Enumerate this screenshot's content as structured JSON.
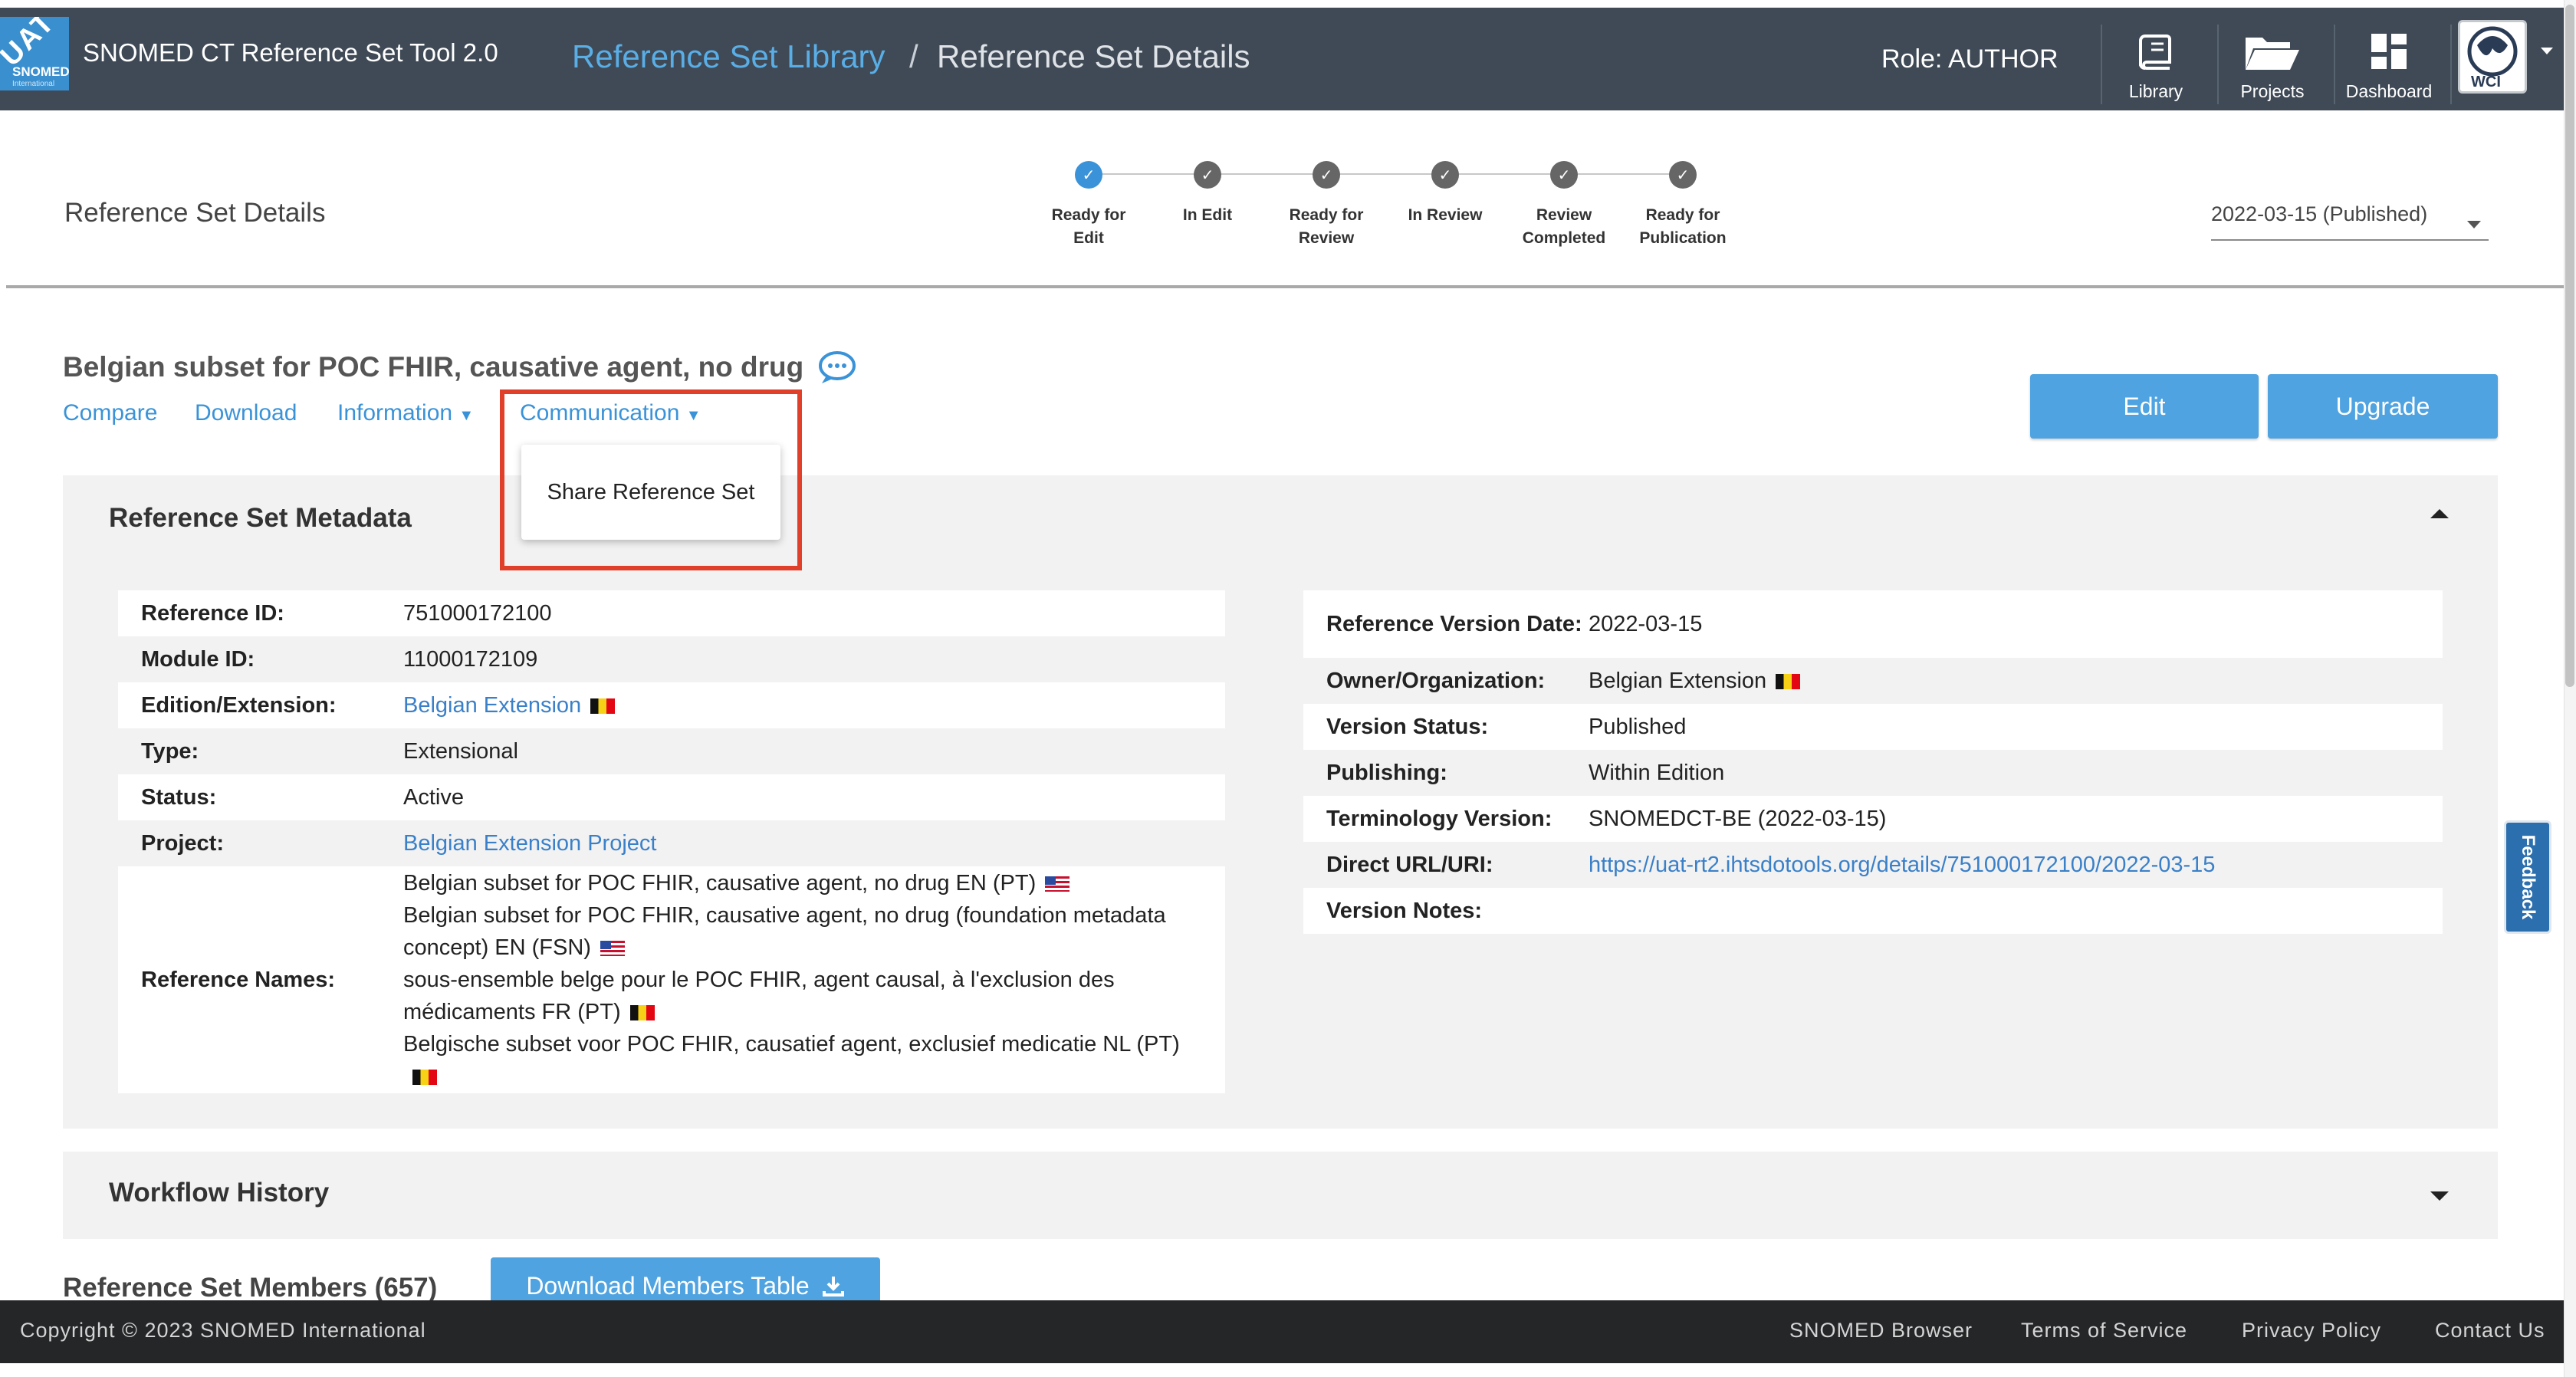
{
  "header": {
    "badge": "UAT",
    "logo_name": "SNOMED",
    "logo_sub": "International",
    "app_title": "SNOMED CT Reference Set Tool 2.0",
    "breadcrumb_link": "Reference Set Library",
    "breadcrumb_sep": "/",
    "breadcrumb_current": "Reference Set Details",
    "role": "Role: AUTHOR",
    "nav": {
      "library": "Library",
      "projects": "Projects",
      "dashboard": "Dashboard"
    },
    "avatar_text": "WCI"
  },
  "page_title": "Reference Set Details",
  "workflow_steps": [
    {
      "label_1": "Ready for",
      "label_2": "Edit",
      "state": "done"
    },
    {
      "label_1": "In Edit",
      "label_2": "",
      "state": "pending"
    },
    {
      "label_1": "Ready for",
      "label_2": "Review",
      "state": "pending"
    },
    {
      "label_1": "In Review",
      "label_2": "",
      "state": "pending"
    },
    {
      "label_1": "Review",
      "label_2": "Completed",
      "state": "pending"
    },
    {
      "label_1": "Ready for",
      "label_2": "Publication",
      "state": "pending"
    }
  ],
  "version_select": "2022-03-15 (Published)",
  "refset": {
    "title": "Belgian subset for POC FHIR, causative agent, no drug",
    "actions": {
      "compare": "Compare",
      "download": "Download",
      "information": "Information",
      "communication": "Communication"
    },
    "dropdown_item": "Share Reference Set",
    "edit_button": "Edit",
    "upgrade_button": "Upgrade"
  },
  "metadata": {
    "title": "Reference Set Metadata",
    "left": {
      "reference_id_label": "Reference ID:",
      "reference_id": "751000172100",
      "module_id_label": "Module ID:",
      "module_id": "11000172109",
      "edition_label": "Edition/Extension:",
      "edition": "Belgian Extension",
      "type_label": "Type:",
      "type": "Extensional",
      "status_label": "Status:",
      "status": "Active",
      "project_label": "Project:",
      "project": "Belgian Extension Project",
      "names_label": "Reference Names:",
      "names": [
        "Belgian subset for POC FHIR, causative agent, no drug EN (PT)",
        "Belgian subset for POC FHIR, causative agent, no drug (foundation metadata concept) EN (FSN)",
        "sous-ensemble belge pour le POC FHIR, agent causal, à l'exclusion des médicaments FR (PT)",
        "Belgische subset voor POC FHIR, causatief agent, exclusief medicatie NL (PT)"
      ]
    },
    "right": {
      "version_date_label": "Reference Version Date:",
      "version_date": "2022-03-15",
      "owner_label": "Owner/Organization:",
      "owner": "Belgian Extension",
      "version_status_label": "Version Status:",
      "version_status": "Published",
      "publishing_label": "Publishing:",
      "publishing": "Within Edition",
      "terminology_label": "Terminology Version:",
      "terminology": "SNOMEDCT-BE (2022-03-15)",
      "url_label": "Direct URL/URI:",
      "url": "https://uat-rt2.ihtsdotools.org/details/751000172100/2022-03-15",
      "notes_label": "Version Notes:",
      "notes": ""
    }
  },
  "workflow_history": "Workflow History",
  "members": {
    "title": "Reference Set Members (657)",
    "download_button": "Download Members Table"
  },
  "feedback": "Feedback",
  "footer": {
    "copyright": "Copyright © 2023 SNOMED International",
    "links": [
      "SNOMED Browser",
      "Terms of Service",
      "Privacy Policy",
      "Contact Us"
    ]
  },
  "colors": {
    "header_bg": "#3f4a56",
    "accent": "#3a93d8",
    "button": "#4fa3e0",
    "highlight": "#e0402a",
    "footer_bg": "#252628"
  }
}
